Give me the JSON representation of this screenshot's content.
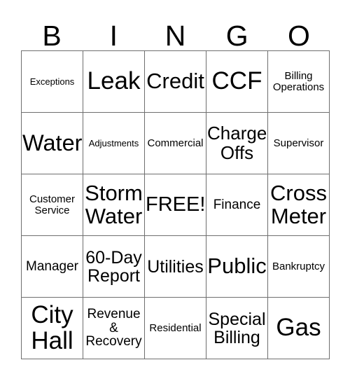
{
  "card": {
    "title": "BINGO",
    "header_letters": [
      "B",
      "I",
      "N",
      "G",
      "O"
    ],
    "grid_size": 5,
    "free_space": "FREE!",
    "colors": {
      "background": "#ffffff",
      "text": "#000000",
      "grid_line": "#6f6f6f"
    },
    "rows": [
      [
        {
          "label": "Exceptions",
          "size": "xs"
        },
        {
          "label": "Leak",
          "size": "xxl"
        },
        {
          "label": "Credit",
          "size": "xl"
        },
        {
          "label": "CCF",
          "size": "xxl"
        },
        {
          "label": "Billing\nOperations",
          "size": "s"
        }
      ],
      [
        {
          "label": "Water",
          "size": "xxl"
        },
        {
          "label": "Adjustments",
          "size": "xs"
        },
        {
          "label": "Commercial",
          "size": "s"
        },
        {
          "label": "Charge\nOffs",
          "size": "xl"
        },
        {
          "label": "Supervisor",
          "size": "s"
        }
      ],
      [
        {
          "label": "Customer\nService",
          "size": "s"
        },
        {
          "label": "Storm\nWater",
          "size": "xl"
        },
        {
          "label": "FREE!",
          "size": "xl"
        },
        {
          "label": "Finance",
          "size": "m"
        },
        {
          "label": "Cross\nMeter",
          "size": "xl"
        }
      ],
      [
        {
          "label": "Manager",
          "size": "m"
        },
        {
          "label": "60-Day\nReport",
          "size": "l"
        },
        {
          "label": "Utilities",
          "size": "l"
        },
        {
          "label": "Public",
          "size": "xl"
        },
        {
          "label": "Bankruptcy",
          "size": "s"
        }
      ],
      [
        {
          "label": "City\nHall",
          "size": "xxl"
        },
        {
          "label": "Revenue\n&\nRecovery",
          "size": "m"
        },
        {
          "label": "Residential",
          "size": "s"
        },
        {
          "label": "Special\nBilling",
          "size": "l"
        },
        {
          "label": "Gas",
          "size": "xxl"
        }
      ]
    ]
  }
}
